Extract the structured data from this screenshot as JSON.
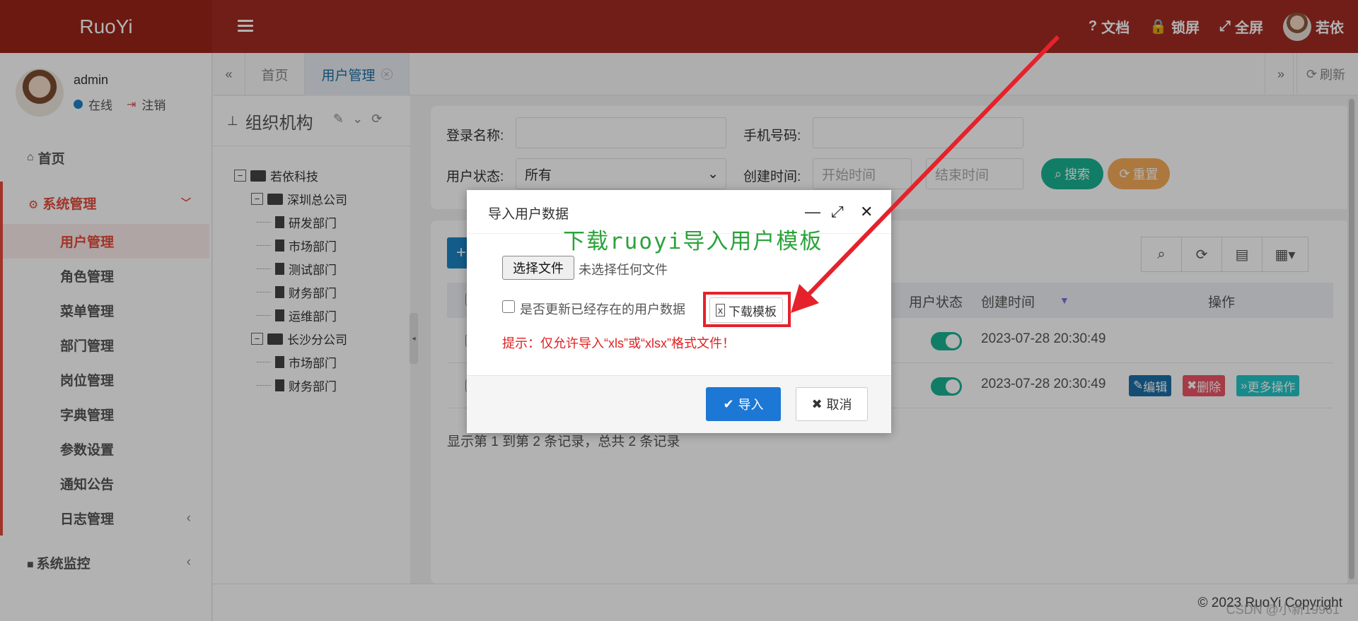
{
  "app": {
    "logo": "RuoYi"
  },
  "topnav": {
    "docs": "文档",
    "lock": "锁屏",
    "fullscreen": "全屏",
    "user": "若依"
  },
  "sidebar": {
    "username": "admin",
    "status": "在线",
    "logout": "注销",
    "home": "首页",
    "group": "系统管理",
    "items": [
      "用户管理",
      "角色管理",
      "菜单管理",
      "部门管理",
      "岗位管理",
      "字典管理",
      "参数设置",
      "通知公告",
      "日志管理"
    ],
    "monitor": "系统监控"
  },
  "tabs": {
    "home": "首页",
    "active": "用户管理",
    "refresh": "刷新"
  },
  "org": {
    "title": "组织机构",
    "root": "若依科技",
    "branch1": "深圳总公司",
    "branch1_children": [
      "研发部门",
      "市场部门",
      "测试部门",
      "财务部门",
      "运维部门"
    ],
    "branch2": "长沙分公司",
    "branch2_children": [
      "市场部门",
      "财务部门"
    ]
  },
  "search": {
    "login_label": "登录名称:",
    "phone_label": "手机号码:",
    "status_label": "用户状态:",
    "status_value": "所有",
    "time_label": "创建时间:",
    "start_placeholder": "开始时间",
    "end_placeholder": "结束时间",
    "search_btn": "搜索",
    "reset_btn": "重置"
  },
  "table": {
    "headers": {
      "status": "用户状态",
      "created": "创建时间",
      "ops": "操作"
    },
    "rows": [
      {
        "created": "2023-07-28 20:30:49"
      },
      {
        "created": "2023-07-28 20:30:49"
      }
    ],
    "edit": "编辑",
    "delete": "删除",
    "more": "更多操作",
    "pager": "显示第 1 到第 2 条记录，总共 2 条记录"
  },
  "footer": {
    "copyright": "© 2023 RuoYi Copyright",
    "watermark": "CSDN @小新19961"
  },
  "modal": {
    "title": "导入用户数据",
    "choose_file": "选择文件",
    "no_file": "未选择任何文件",
    "update_existing": "是否更新已经存在的用户数据",
    "download_template": "下载模板",
    "hint": "提示：仅允许导入“xls”或“xlsx”格式文件！",
    "import_btn": "导入",
    "cancel_btn": "取消"
  },
  "annotation": {
    "text": "下载ruoyi导入用户模板"
  },
  "colors": {
    "topbar": "#a32c24",
    "accent": "#e64b3b",
    "primary": "#1c84c6",
    "success": "#1ab394",
    "warning": "#f8ac59",
    "danger": "#ed5565",
    "info": "#23c6c8",
    "annotation_green": "#2aa33a",
    "annotation_red": "#e5222b"
  }
}
